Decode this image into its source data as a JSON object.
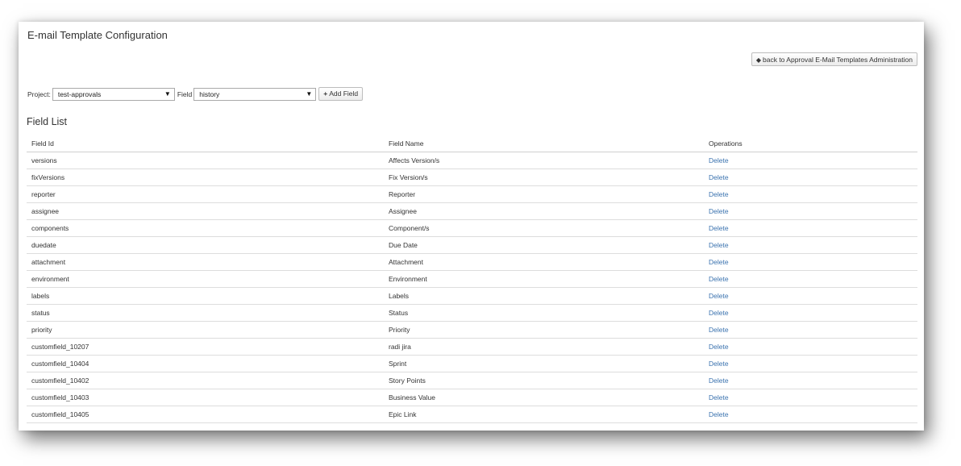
{
  "page": {
    "title": "E-mail Template Configuration",
    "back_button": {
      "icon": "left-arrow-icon",
      "arrow_glyph": "◆",
      "label": "back to Approval E-Mail Templates Administration"
    }
  },
  "filters": {
    "project_label": "Project:",
    "project_value": "test-approvals",
    "field_label": "Field",
    "field_value": "history",
    "caret_glyph": "▼",
    "add_button": {
      "plus_glyph": "+",
      "label": "Add Field"
    }
  },
  "field_list": {
    "title": "Field List",
    "columns": [
      "Field Id",
      "Field Name",
      "Operations"
    ],
    "rows": [
      {
        "id": "versions",
        "name": "Affects Version/s",
        "op": "Delete"
      },
      {
        "id": "fixVersions",
        "name": "Fix Version/s",
        "op": "Delete"
      },
      {
        "id": "reporter",
        "name": "Reporter",
        "op": "Delete"
      },
      {
        "id": "assignee",
        "name": "Assignee",
        "op": "Delete"
      },
      {
        "id": "components",
        "name": "Component/s",
        "op": "Delete"
      },
      {
        "id": "duedate",
        "name": "Due Date",
        "op": "Delete"
      },
      {
        "id": "attachment",
        "name": "Attachment",
        "op": "Delete"
      },
      {
        "id": "environment",
        "name": "Environment",
        "op": "Delete"
      },
      {
        "id": "labels",
        "name": "Labels",
        "op": "Delete"
      },
      {
        "id": "status",
        "name": "Status",
        "op": "Delete"
      },
      {
        "id": "priority",
        "name": "Priority",
        "op": "Delete"
      },
      {
        "id": "customfield_10207",
        "name": "radi jira",
        "op": "Delete"
      },
      {
        "id": "customfield_10404",
        "name": "Sprint",
        "op": "Delete"
      },
      {
        "id": "customfield_10402",
        "name": "Story Points",
        "op": "Delete"
      },
      {
        "id": "customfield_10403",
        "name": "Business Value",
        "op": "Delete"
      },
      {
        "id": "customfield_10405",
        "name": "Epic Link",
        "op": "Delete"
      }
    ]
  },
  "colors": {
    "link": "#3b73af",
    "text": "#333333"
  }
}
